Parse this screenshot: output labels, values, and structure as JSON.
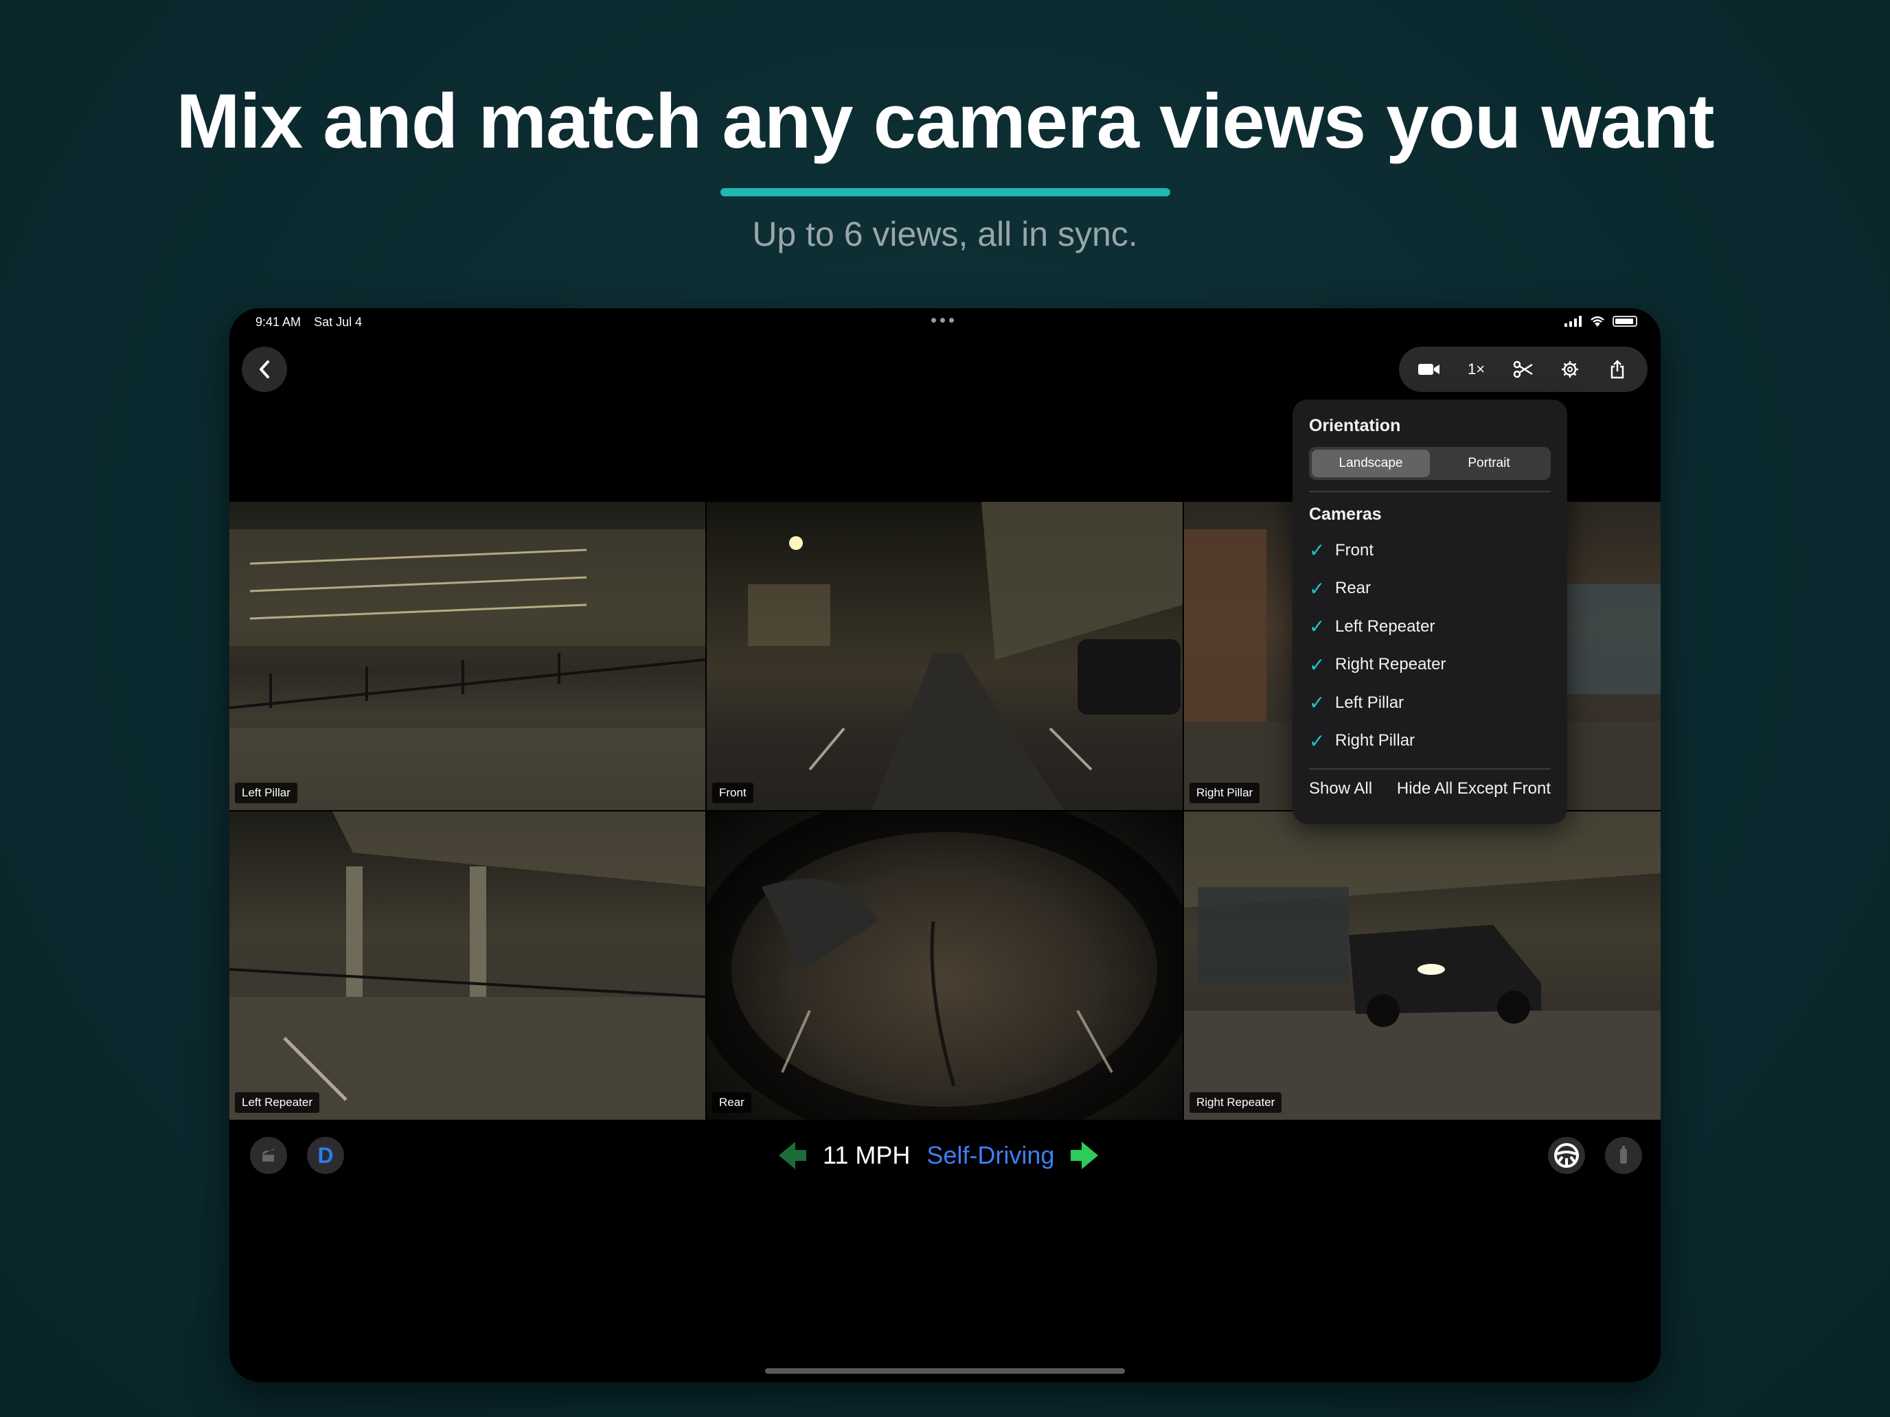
{
  "marketing": {
    "headline": "Mix and match any camera views you want",
    "subhead": "Up to 6 views, all in sync.",
    "accent_color": "#1fb8b4"
  },
  "status_bar": {
    "time": "9:41 AM",
    "date": "Sat Jul 4"
  },
  "toolbar": {
    "speed_label": "1×",
    "icons": [
      "camera-icon",
      "scissors-icon",
      "gear-icon",
      "share-icon"
    ]
  },
  "cameras_grid": [
    {
      "label": "Left Pillar"
    },
    {
      "label": "Front"
    },
    {
      "label": "Right Pillar"
    },
    {
      "label": "Left Repeater"
    },
    {
      "label": "Rear"
    },
    {
      "label": "Right Repeater"
    }
  ],
  "popover": {
    "orientation_title": "Orientation",
    "orientation_options": [
      "Landscape",
      "Portrait"
    ],
    "orientation_selected": "Landscape",
    "cameras_title": "Cameras",
    "camera_items": [
      {
        "label": "Front",
        "checked": true
      },
      {
        "label": "Rear",
        "checked": true
      },
      {
        "label": "Left Repeater",
        "checked": true
      },
      {
        "label": "Right Repeater",
        "checked": true
      },
      {
        "label": "Left Pillar",
        "checked": true
      },
      {
        "label": "Right Pillar",
        "checked": true
      }
    ],
    "show_all": "Show All",
    "hide_all_except": "Hide All Except Front",
    "check_color": "#1fc7c4"
  },
  "drive_bar": {
    "gear": "D",
    "speed": "11 MPH",
    "mode": "Self-Driving",
    "mode_color": "#3f7ef5"
  }
}
